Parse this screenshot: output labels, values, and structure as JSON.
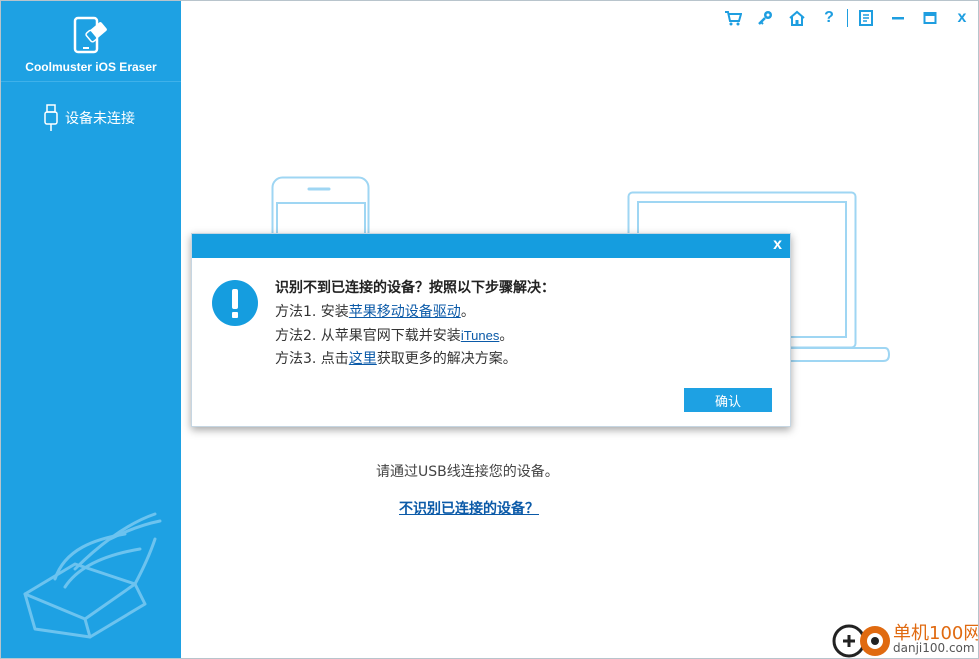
{
  "app": {
    "title": "Coolmuster iOS Eraser",
    "device_status": "设备未连接"
  },
  "toolbar": {
    "icons": [
      "cart-icon",
      "key-icon",
      "home-icon",
      "help-icon",
      "feedback-icon",
      "minimize-icon",
      "maximize-icon",
      "close-icon"
    ],
    "help_label": "?",
    "close_label": "x"
  },
  "main": {
    "hint": "请通过USB线连接您的设备。",
    "not_recognized_link": "不识别已连接的设备？"
  },
  "dialog": {
    "close_label": "x",
    "heading": "识别不到已连接的设备？按照以下步骤解决：",
    "method1_prefix": "方法1. 安装",
    "method1_link": "苹果移动设备驱动",
    "method1_suffix": "。",
    "method2_prefix": "方法2. 从苹果官网下载并安装",
    "method2_link": "iTunes",
    "method2_suffix": "。",
    "method3_prefix": "方法3. 点击",
    "method3_link": "这里",
    "method3_suffix": "获取更多的解决方案。",
    "confirm_label": "确认"
  },
  "watermark": {
    "name": "单机100网",
    "url": "danji100.com"
  },
  "colors": {
    "sidebar": "#1ea1e3",
    "accent": "#159ddf",
    "link": "#0b5aa8",
    "watermark": "#e06a10"
  }
}
